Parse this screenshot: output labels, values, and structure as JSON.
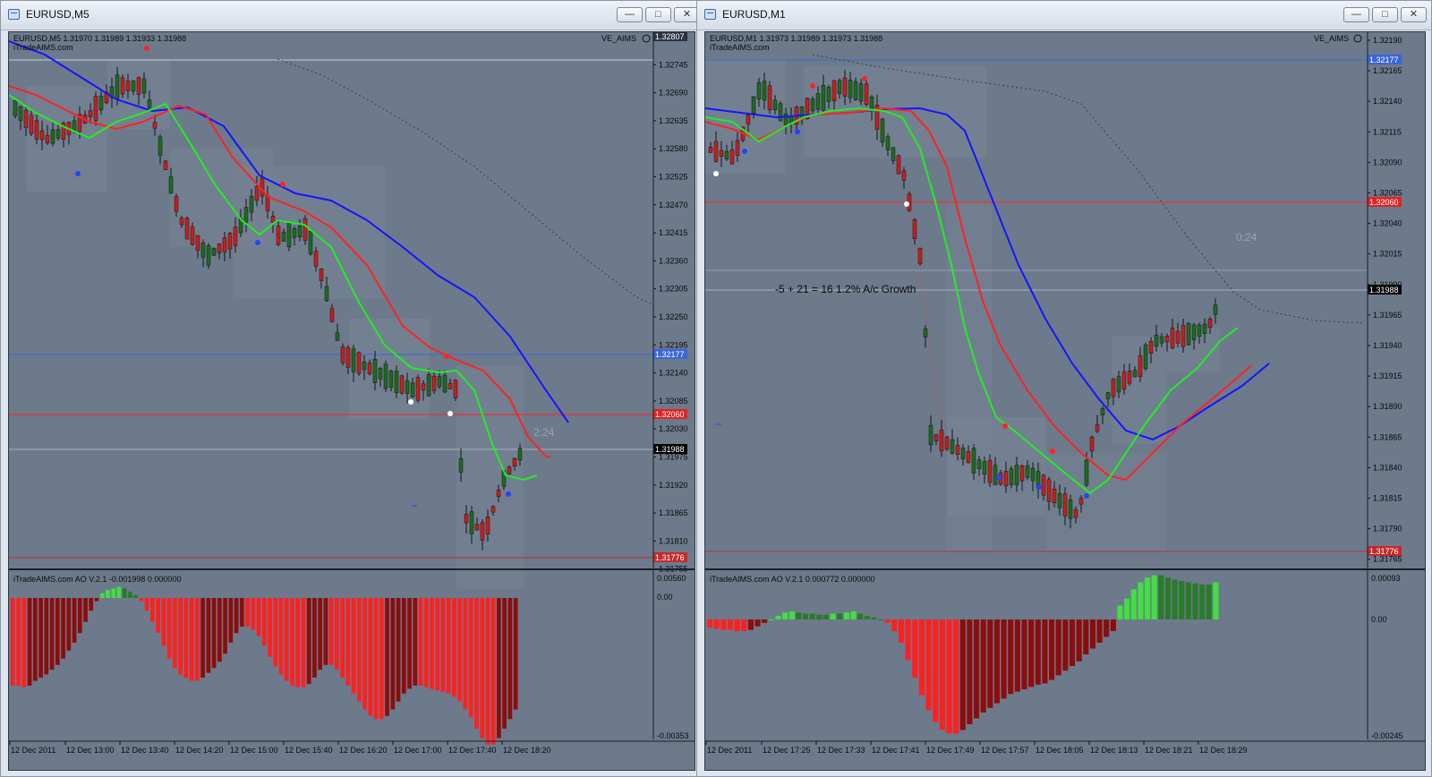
{
  "windows": [
    {
      "title": "EURUSD,M5",
      "buttons": {
        "minimize": "—",
        "restore": "□",
        "close": "✕"
      },
      "header_line": "EURUSD,M5  1.31970 1.31989 1.31933 1.31988",
      "watermark": "iTradeAIMS.com",
      "indicator_label": "VE_AIMS",
      "price_labels": [
        "1.32800",
        "1.32745",
        "1.32690",
        "1.32635",
        "1.32580",
        "1.32525",
        "1.32470",
        "1.32415",
        "1.32360",
        "1.32305",
        "1.32250",
        "1.32195",
        "1.32140",
        "1.32085",
        "1.32030",
        "1.31975",
        "1.31920",
        "1.31865",
        "1.31810",
        "1.31755"
      ],
      "badges": {
        "top": "1.32807",
        "blue": "1.32177",
        "red": "1.32060",
        "current": "1.31988",
        "bottom": "1.31776"
      },
      "timer": "2:24",
      "annotation": "",
      "ao_label": "iTradeAIMS.com AO V.2.1 -0.001998 0.000000",
      "ao_scale": [
        "0.00560",
        "0.00",
        "-0.00353"
      ],
      "time_labels": [
        "12 Dec 2011",
        "12 Dec 13:00",
        "12 Dec 13:40",
        "12 Dec 14:20",
        "12 Dec 15:00",
        "12 Dec 15:40",
        "12 Dec 16:20",
        "12 Dec 17:00",
        "12 Dec 17:40",
        "12 Dec 18:20"
      ],
      "colors": {
        "up": "#1f6b1f",
        "down": "#c81e1e",
        "ema_fast": "#22ee22",
        "ema_mid": "#ff2222",
        "ema_slow": "#1515ff",
        "ao_red": "#ff2020",
        "ao_darkred": "#8a0e0e",
        "ao_green": "#44dd44"
      }
    },
    {
      "title": "EURUSD,M1",
      "buttons": {
        "minimize": "—",
        "restore": "□",
        "close": "✕"
      },
      "header_line": "EURUSD,M1  1.31973 1.31989 1.31973 1.31988",
      "watermark": "iTradeAIMS.com",
      "indicator_label": "VE_AIMS",
      "price_labels": [
        "1.32190",
        "1.32165",
        "1.32140",
        "1.32115",
        "1.32090",
        "1.32065",
        "1.32040",
        "1.32015",
        "1.31990",
        "1.31965",
        "1.31940",
        "1.31915",
        "1.31890",
        "1.31865",
        "1.31840",
        "1.31815",
        "1.31790",
        "1.31765"
      ],
      "badges": {
        "top": "",
        "blue": "1.32177",
        "red": "1.32060",
        "current": "1.31988",
        "bottom": "1.31776"
      },
      "timer": "0:24",
      "annotation": "-5 + 21 = 16 1.2% A/c Growth",
      "ao_label": "iTradeAIMS.com AO V.2.1 0.000772 0.000000",
      "ao_scale": [
        "0.00093",
        "0.00",
        "-0.00245"
      ],
      "time_labels": [
        "12 Dec 2011",
        "12 Dec 17:25",
        "12 Dec 17:33",
        "12 Dec 17:41",
        "12 Dec 17:49",
        "12 Dec 17:57",
        "12 Dec 18:05",
        "12 Dec 18:13",
        "12 Dec 18:21",
        "12 Dec 18:29"
      ],
      "colors": {
        "up": "#1f6b1f",
        "down": "#c81e1e",
        "ema_fast": "#22ee22",
        "ema_mid": "#ff2222",
        "ema_slow": "#1515ff",
        "ao_red": "#ff2020",
        "ao_darkred": "#8a0e0e",
        "ao_green": "#44dd44"
      }
    }
  ]
}
